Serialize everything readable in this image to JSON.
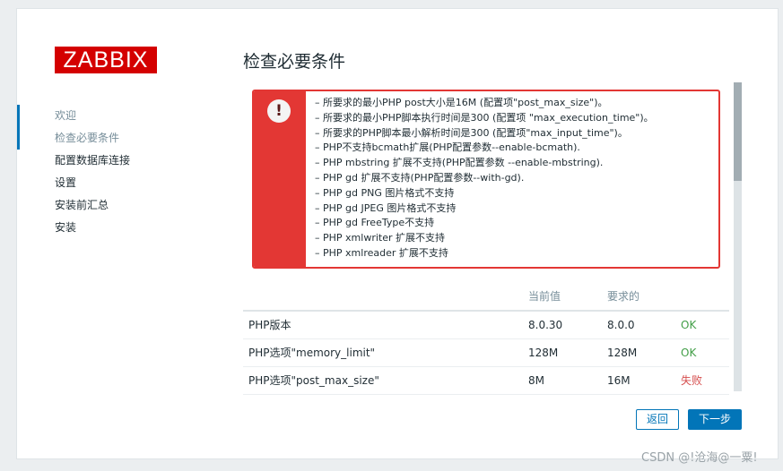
{
  "brand": {
    "logo_text": "ZABBIX"
  },
  "nav": {
    "items": [
      {
        "label": "欢迎",
        "state": "done"
      },
      {
        "label": "检查必要条件",
        "state": "active"
      },
      {
        "label": "配置数据库连接",
        "state": "pending"
      },
      {
        "label": "设置",
        "state": "pending"
      },
      {
        "label": "安装前汇总",
        "state": "pending"
      },
      {
        "label": "安装",
        "state": "pending"
      }
    ]
  },
  "page": {
    "title": "检查必要条件"
  },
  "alert": {
    "icon": "exclamation-icon",
    "messages": [
      "所要求的最小PHP post大小是16M (配置项\"post_max_size\")。",
      "所要求的最小PHP脚本执行时间是300 (配置项 \"max_execution_time\")。",
      "所要求的PHP脚本最小解析时间是300 (配置项\"max_input_time\")。",
      "PHP不支持bcmath扩展(PHP配置参数--enable-bcmath).",
      "PHP mbstring 扩展不支持(PHP配置参数 --enable-mbstring).",
      "PHP gd 扩展不支持(PHP配置参数--with-gd).",
      "PHP gd PNG 图片格式不支持",
      "PHP gd JPEG 图片格式不支持",
      "PHP gd FreeType不支持",
      "PHP xmlwriter 扩展不支持",
      "PHP xmlreader 扩展不支持"
    ]
  },
  "requirements": {
    "headers": {
      "name": "",
      "current": "当前值",
      "required": "要求的",
      "status": ""
    },
    "rows": [
      {
        "name": "PHP版本",
        "current": "8.0.30",
        "required": "8.0.0",
        "status": "OK",
        "ok": true
      },
      {
        "name": "PHP选项\"memory_limit\"",
        "current": "128M",
        "required": "128M",
        "status": "OK",
        "ok": true
      },
      {
        "name": "PHP选项\"post_max_size\"",
        "current": "8M",
        "required": "16M",
        "status": "失败",
        "ok": false
      }
    ]
  },
  "buttons": {
    "back": "返回",
    "next": "下一步"
  },
  "watermark": "CSDN @!沧海@一粟!",
  "colors": {
    "brand": "#d40000",
    "accent": "#0275b8",
    "error": "#e33734",
    "ok": "#429e47",
    "fail": "#d64e4e"
  }
}
